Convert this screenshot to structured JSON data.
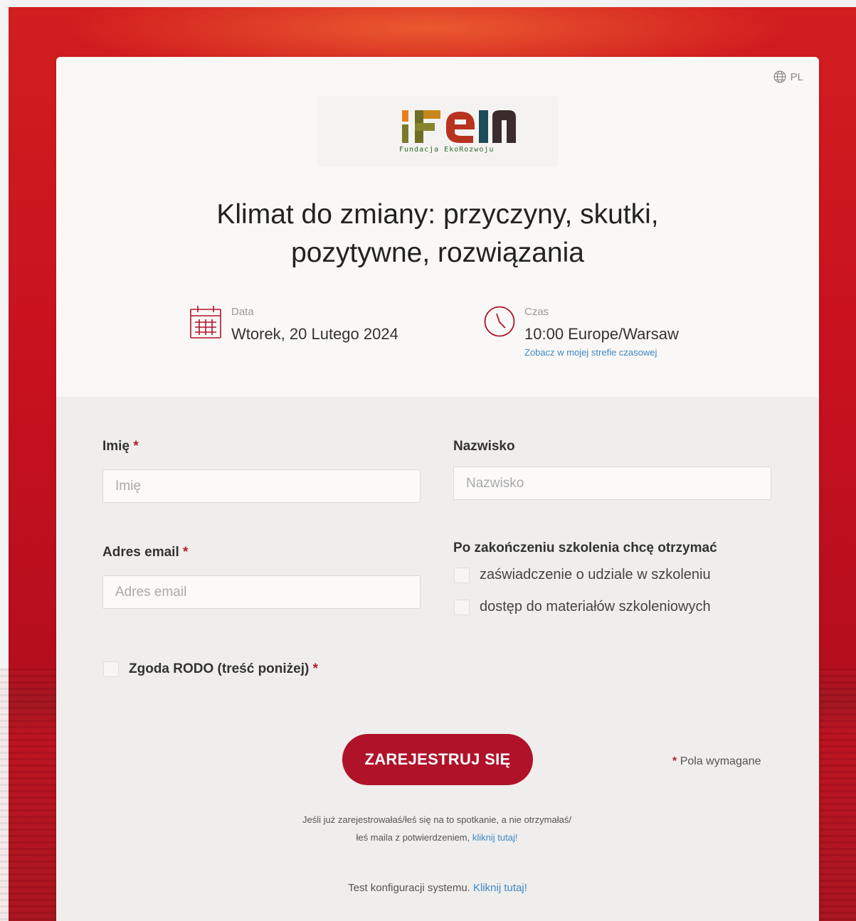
{
  "header": {
    "language": "PL"
  },
  "logo": {
    "text": "Fundacja EkoRozwoju"
  },
  "event": {
    "title_line1": "Klimat do zmiany: przyczyny, skutki,",
    "title_line2": "pozytywne, rozwiązania",
    "date_label": "Data",
    "date_value": "Wtorek, 20 Lutego 2024",
    "time_label": "Czas",
    "time_value": "10:00 Europe/Warsaw",
    "timezone_link": "Zobacz w mojej strefie czasowej"
  },
  "form": {
    "first_name_label": "Imię",
    "first_name_placeholder": "Imię",
    "first_name_value": "",
    "last_name_label": "Nazwisko",
    "last_name_placeholder": "Nazwisko",
    "last_name_value": "",
    "email_label": "Adres email",
    "email_placeholder": "Adres email",
    "email_value": "",
    "after_training_label": "Po zakończeniu szkolenia chcę otrzymać",
    "option_certificate": "zaświadczenie o udziale w szkoleniu",
    "option_materials": "dostęp do materiałów szkoleniowych",
    "gdpr_consent": "Zgoda RODO (treść poniżej)",
    "required_marker": "*",
    "submit_label": "ZAREJESTRUJ SIĘ",
    "required_fields_note": "Pola wymagane"
  },
  "footer": {
    "resend_text": "Jeśli już zarejestrowałaś/łeś się na to spotkanie, a nie otrzymałaś/łeś maila z potwierdzeniem,",
    "resend_link": "kliknij tutaj!",
    "system_test_text": "Test konfiguracji systemu.",
    "system_test_link": "Kliknij tutaj!"
  },
  "colors": {
    "accent": "#b0122a",
    "link": "#3f86c6",
    "background": "#c8111f"
  },
  "icons": {
    "language": "globe-icon",
    "date": "calendar-icon",
    "time": "clock-icon"
  }
}
